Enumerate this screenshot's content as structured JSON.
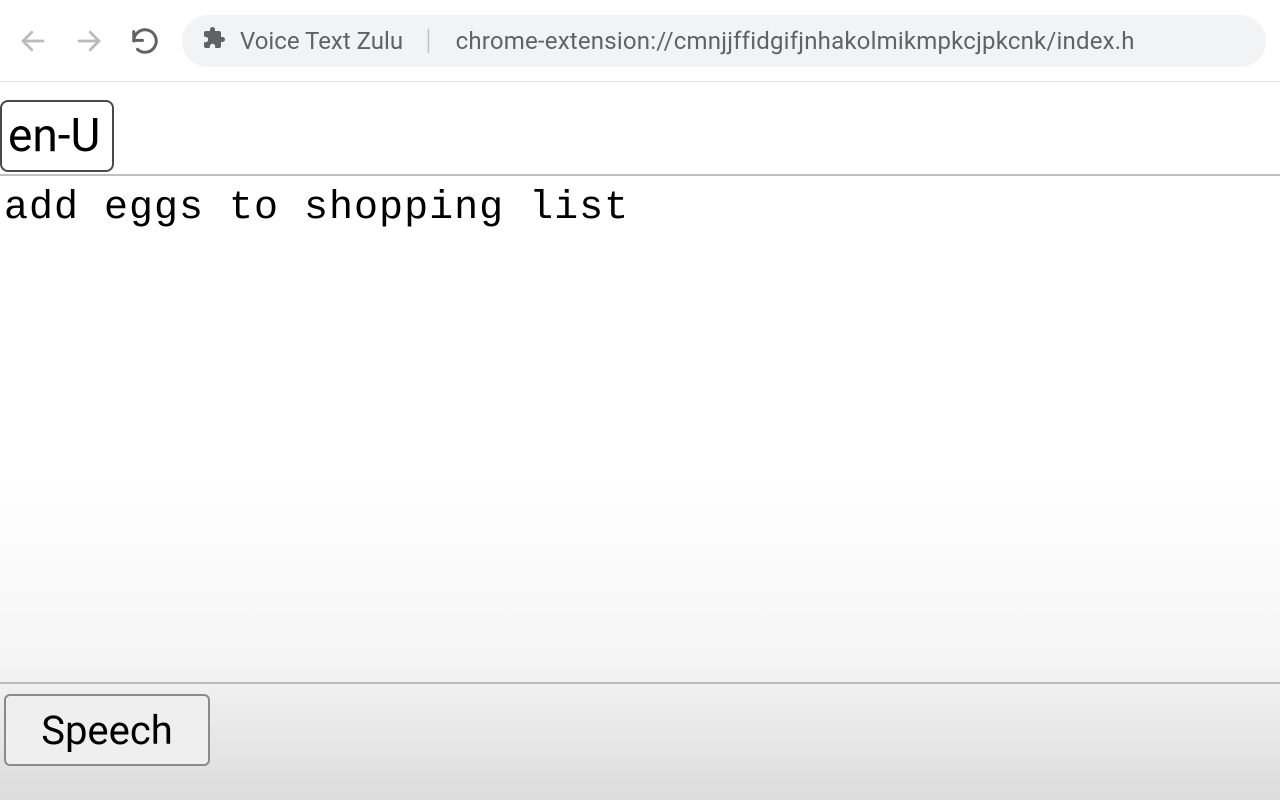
{
  "browser": {
    "page_title": "Voice Text Zulu",
    "url_visible": "chrome-extension://cmnjjffidgifjnhakolmikmpkcjpkcnk/index.h"
  },
  "page": {
    "language_selected_display": "en-U",
    "transcript": "add eggs to shopping list",
    "speech_button_label": "Speech"
  }
}
